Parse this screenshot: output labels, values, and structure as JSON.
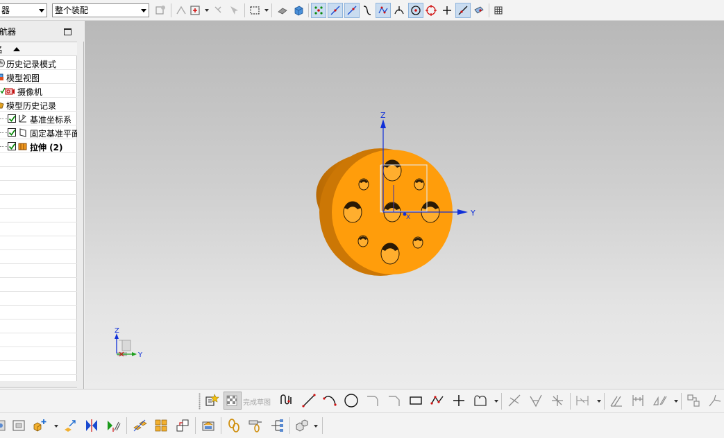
{
  "toolbar": {
    "selection_filter_value": "器",
    "assembly_scope_value": "整个装配"
  },
  "navigator": {
    "title": "导航器",
    "sort_column": "名",
    "items": [
      {
        "label": "历史记录模式",
        "icon": "history-mode-icon"
      },
      {
        "label": "模型视图",
        "icon": "model-views-icon"
      },
      {
        "label": "摄像机",
        "icon": "camera-icon"
      },
      {
        "label": "模型历史记录",
        "icon": "model-history-icon"
      },
      {
        "label": "基准坐标系",
        "icon": "datum-csys-icon",
        "checked": true
      },
      {
        "label": "固定基准平面",
        "icon": "datum-plane-icon",
        "checked": true
      },
      {
        "label": "拉伸 (2)",
        "icon": "extrude-icon",
        "checked": true,
        "bold": true
      }
    ]
  },
  "viewport": {
    "axis_z": "Z",
    "axis_y": "Y",
    "axis_x": "X",
    "triad_z": "Z",
    "triad_y": "Y"
  },
  "sketch_toolbar": {
    "finish_sketch_label": "完成草图"
  },
  "colors": {
    "part_face": "#ff9d0b",
    "part_side": "#d77e05",
    "axis_blue": "#1030d8"
  }
}
